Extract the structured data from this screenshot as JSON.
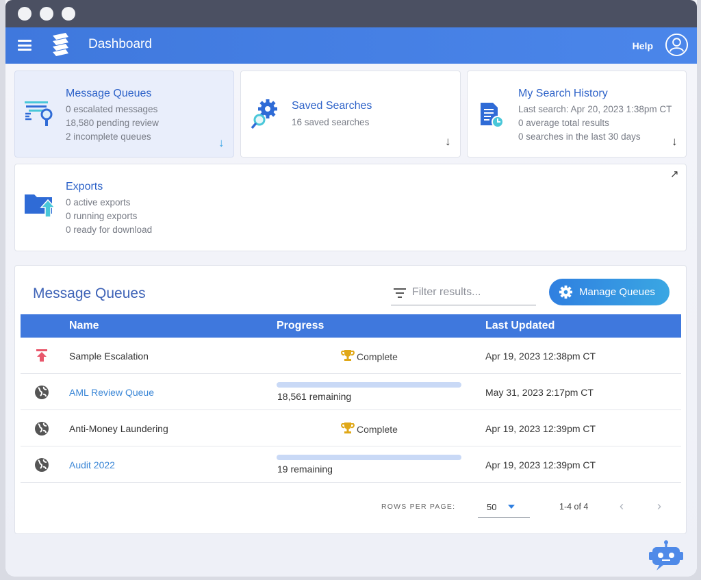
{
  "window": {
    "controls": [
      "close",
      "minimize",
      "maximize"
    ]
  },
  "appbar": {
    "menu_icon": "hamburger-icon",
    "logo_icon": "stacked-layers-logo",
    "title": "Dashboard",
    "help": "Help",
    "user_icon": "user-circle-icon"
  },
  "cards": {
    "message_queues": {
      "title": "Message Queues",
      "lines": [
        "0 escalated messages",
        "18,580 pending review",
        "2 incomplete queues"
      ],
      "icon": "funnel-search-icon",
      "arrow": "↓"
    },
    "saved_searches": {
      "title": "Saved Searches",
      "lines": [
        "16 saved searches"
      ],
      "icon": "gear-magnifier-icon",
      "arrow": "↓"
    },
    "search_history": {
      "title": "My Search History",
      "lines": [
        "Last search: Apr 20, 2023 1:38pm CT",
        "0 average total results",
        "0 searches in the last 30 days"
      ],
      "icon": "document-clock-icon",
      "arrow": "↓"
    },
    "exports": {
      "title": "Exports",
      "lines": [
        "0 active exports",
        "0 running exports",
        "0 ready for download"
      ],
      "icon": "folder-upload-icon",
      "arrow": "↗"
    }
  },
  "queues_panel": {
    "title": "Message Queues",
    "filter_placeholder": "Filter results...",
    "manage_button": "Manage Queues",
    "columns": [
      "Name",
      "Progress",
      "Last Updated"
    ],
    "rows": [
      {
        "icon": "escalation-arrow-icon",
        "name": "Sample Escalation",
        "link": false,
        "status": "Complete",
        "remaining": null,
        "updated": "Apr 19, 2023 12:38pm CT"
      },
      {
        "icon": "globe-icon",
        "name": "AML Review Queue",
        "link": true,
        "status": null,
        "remaining": "18,561 remaining",
        "updated": "May 31, 2023 2:17pm CT"
      },
      {
        "icon": "globe-icon",
        "name": "Anti-Money Laundering",
        "link": false,
        "status": "Complete",
        "remaining": null,
        "updated": "Apr 19, 2023 12:39pm CT"
      },
      {
        "icon": "globe-icon",
        "name": "Audit 2022",
        "link": true,
        "status": null,
        "remaining": "19 remaining",
        "updated": "Apr 19, 2023 12:39pm CT"
      }
    ],
    "footer": {
      "rows_per_page_label": "ROWS PER PAGE:",
      "rows_per_page": "50",
      "range": "1-4 of 4"
    }
  },
  "colors": {
    "appbar": "#3f78dd",
    "link": "#3a86d6",
    "title_blue": "#2d62c8",
    "trophy": "#e0a818",
    "escalation": "#e8566b"
  },
  "assistant_icon": "chatbot-robot-icon"
}
